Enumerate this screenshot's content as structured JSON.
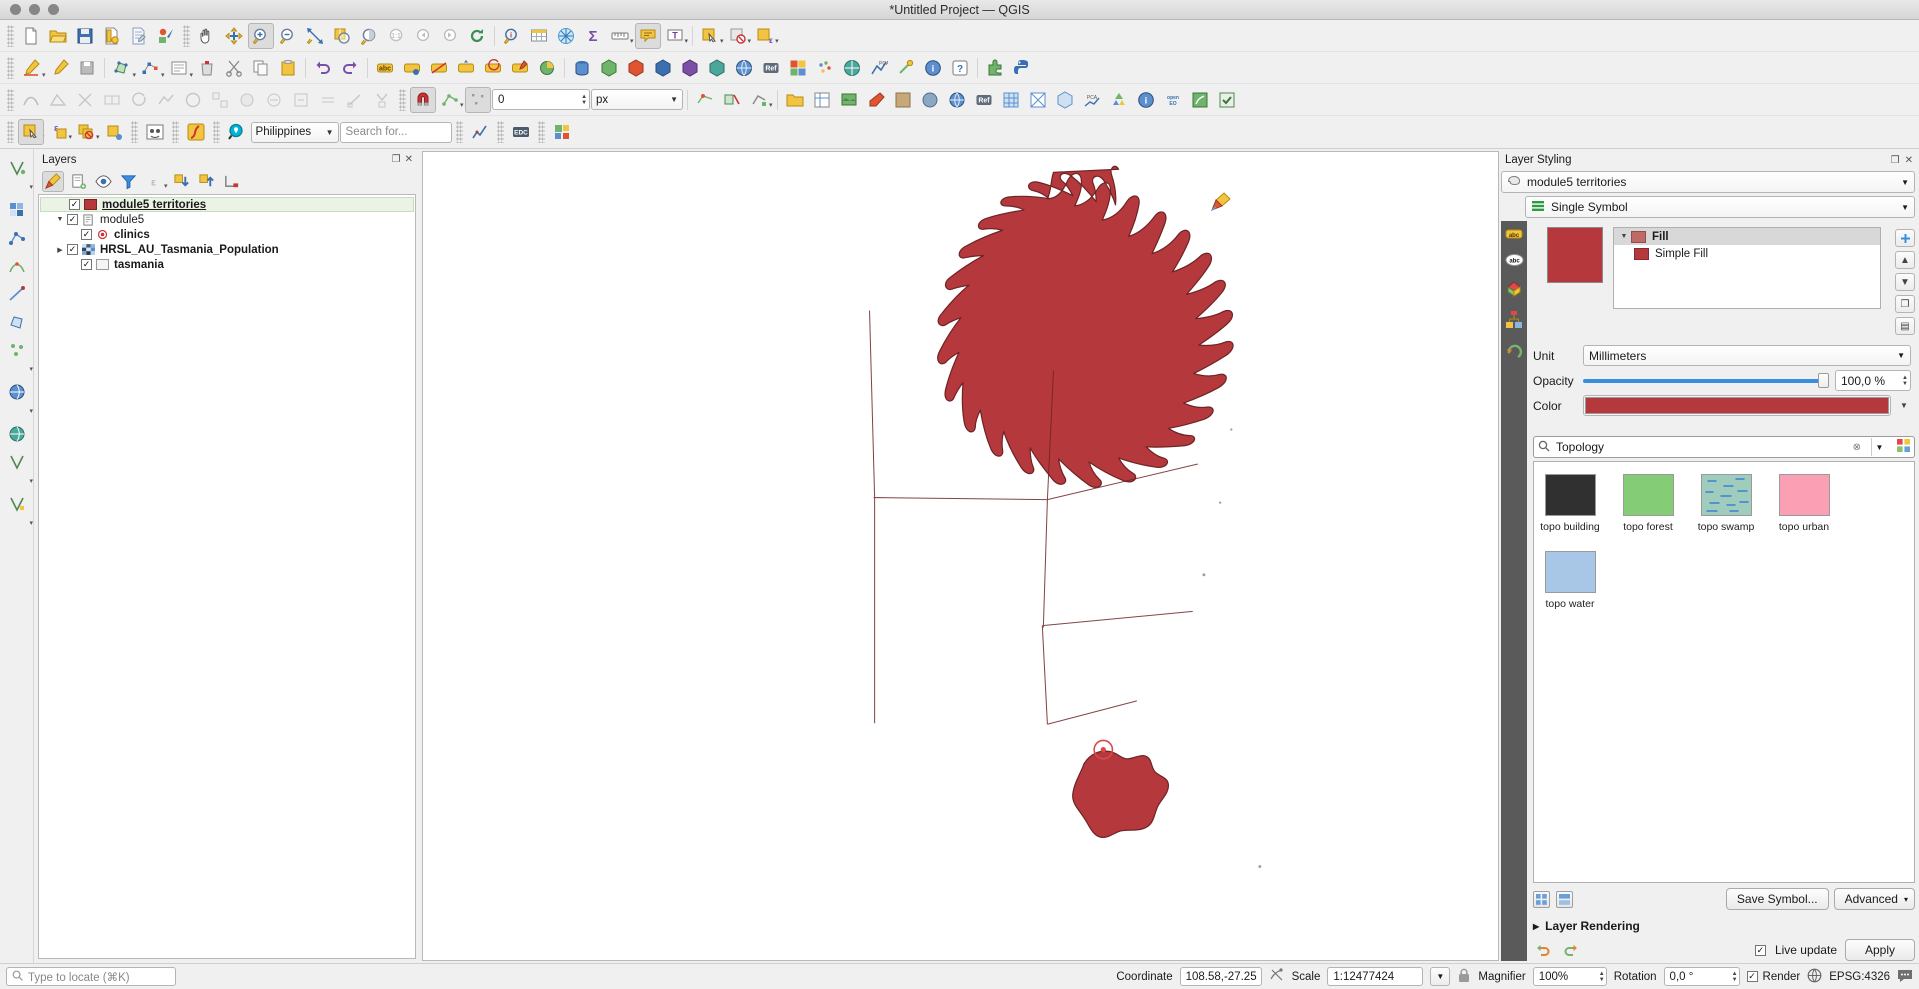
{
  "window": {
    "title": "*Untitled Project — QGIS"
  },
  "toolbars": {
    "row1": [
      {
        "name": "new-project-icon",
        "glyph": "page"
      },
      {
        "name": "open-project-icon",
        "glyph": "folder"
      },
      {
        "name": "save-project-icon",
        "glyph": "save"
      },
      {
        "name": "save-project-as-icon",
        "glyph": "saveas"
      },
      {
        "name": "new-print-layout-icon",
        "glyph": "layout"
      },
      {
        "name": "style-manager-icon",
        "glyph": "style"
      },
      {
        "name": "pan-map-icon",
        "glyph": "hand"
      },
      {
        "name": "pan-to-selection-icon",
        "glyph": "panselect"
      },
      {
        "name": "zoom-in-icon",
        "glyph": "zoomin"
      },
      {
        "name": "zoom-out-icon",
        "glyph": "zoomout"
      },
      {
        "name": "zoom-full-icon",
        "glyph": "zoomfull"
      },
      {
        "name": "zoom-to-selection-icon",
        "glyph": "zoomsel"
      },
      {
        "name": "zoom-to-layer-icon",
        "glyph": "zoomlayer"
      },
      {
        "name": "zoom-native-icon",
        "glyph": "zoomnative"
      },
      {
        "name": "zoom-last-icon",
        "glyph": "zoomlast"
      },
      {
        "name": "zoom-next-icon",
        "glyph": "zoomnext"
      },
      {
        "name": "refresh-icon",
        "glyph": "refresh"
      },
      {
        "name": "identify-features-icon",
        "glyph": "identify"
      },
      {
        "name": "open-attribute-table-icon",
        "glyph": "table"
      },
      {
        "name": "statistical-summary-icon",
        "glyph": "stats"
      },
      {
        "name": "sum-icon",
        "glyph": "sigma"
      },
      {
        "name": "measure-line-icon",
        "glyph": "ruler"
      },
      {
        "name": "map-tips-icon",
        "glyph": "maptip"
      },
      {
        "name": "new-text-annotation-icon",
        "glyph": "textann"
      },
      {
        "name": "deselect-features-icon",
        "glyph": "deselect"
      },
      {
        "name": "select-features-icon",
        "glyph": "select"
      }
    ],
    "row2": [
      {
        "name": "current-edits-icon",
        "glyph": "pencil"
      },
      {
        "name": "toggle-editing-icon",
        "glyph": "editpen"
      },
      {
        "name": "save-layer-edits-icon",
        "glyph": "savelayer"
      },
      {
        "name": "add-feature-icon",
        "glyph": "addfeature"
      },
      {
        "name": "vertex-tool-icon",
        "glyph": "vertex"
      },
      {
        "name": "modify-attributes-icon",
        "glyph": "modifyattr"
      },
      {
        "name": "delete-selected-icon",
        "glyph": "delete"
      },
      {
        "name": "cut-features-icon",
        "glyph": "cut"
      },
      {
        "name": "copy-features-icon",
        "glyph": "copy"
      },
      {
        "name": "paste-features-icon",
        "glyph": "paste"
      },
      {
        "name": "undo-icon",
        "glyph": "undo"
      },
      {
        "name": "redo-icon",
        "glyph": "redo"
      },
      {
        "name": "label-icon",
        "glyph": "abclabel"
      },
      {
        "name": "pin-labels-icon",
        "glyph": "pinlabel"
      },
      {
        "name": "show-hide-labels-icon",
        "glyph": "showlabel"
      },
      {
        "name": "move-label-icon",
        "glyph": "movelabel"
      },
      {
        "name": "rotate-label-icon",
        "glyph": "rotatelabel"
      },
      {
        "name": "change-label-icon",
        "glyph": "changelabel"
      },
      {
        "name": "open-data-source-manager-icon",
        "glyph": "datasource"
      },
      {
        "name": "new-shapefile-layer-icon",
        "glyph": "newshape"
      },
      {
        "name": "new-geopackage-icon",
        "glyph": "geopackage"
      },
      {
        "name": "new-spatialite-icon",
        "glyph": "spatialite"
      },
      {
        "name": "add-wms-layer-icon",
        "glyph": "wms"
      },
      {
        "name": "add-vector-tile-icon",
        "glyph": "vectortile"
      },
      {
        "name": "georeferencer-icon",
        "glyph": "georef"
      },
      {
        "name": "processing-toolbox-icon",
        "glyph": "toolbox"
      },
      {
        "name": "help-icon",
        "glyph": "help"
      },
      {
        "name": "plugin-icon",
        "glyph": "plugin"
      },
      {
        "name": "python-console-icon",
        "glyph": "python"
      }
    ],
    "snapping": {
      "tolerance_value": "0",
      "unit_value": "px"
    },
    "locator": {
      "scope_label": "Philippines",
      "search_placeholder": "Search for..."
    }
  },
  "layers_panel": {
    "title": "Layers",
    "toolbar_buttons": [
      {
        "name": "open-layer-styling-panel-icon"
      },
      {
        "name": "add-group-icon"
      },
      {
        "name": "manage-map-themes-icon"
      },
      {
        "name": "filter-legend-icon"
      },
      {
        "name": "filter-legend-expression-icon"
      },
      {
        "name": "expand-all-icon"
      },
      {
        "name": "collapse-all-icon"
      },
      {
        "name": "remove-layer-icon"
      }
    ],
    "tree": [
      {
        "name": "module5 territories",
        "checked": true,
        "selected": true,
        "bold": true,
        "underline": true,
        "symbol": "fill-red",
        "indent": 1,
        "twisty": ""
      },
      {
        "name": "module5",
        "checked": true,
        "selected": false,
        "bold": false,
        "underline": false,
        "symbol": "geopackage",
        "indent": 0,
        "twisty": "▾"
      },
      {
        "name": "clinics",
        "checked": true,
        "selected": false,
        "bold": true,
        "underline": false,
        "symbol": "point-red",
        "indent": 2,
        "twisty": ""
      },
      {
        "name": "HRSL_AU_Tasmania_Population",
        "checked": true,
        "selected": false,
        "bold": true,
        "underline": false,
        "symbol": "raster",
        "indent": 2,
        "twisty": "▸"
      },
      {
        "name": "tasmania",
        "checked": true,
        "selected": false,
        "bold": true,
        "underline": false,
        "symbol": "fill-white",
        "indent": 2,
        "twisty": ""
      }
    ]
  },
  "styling_panel": {
    "title": "Layer Styling",
    "layer_name": "module5 territories",
    "renderer": "Single Symbol",
    "vtabs": [
      {
        "name": "labels-tab",
        "glyph": "abc-tag"
      },
      {
        "name": "masks-tab",
        "glyph": "abc-mask"
      },
      {
        "name": "3d-view-tab",
        "glyph": "cube"
      },
      {
        "name": "diagrams-tab",
        "glyph": "diagram"
      },
      {
        "name": "history-tab",
        "glyph": "history"
      }
    ],
    "symbol_tree": [
      {
        "label": "Fill",
        "color": "#c06a66",
        "header": true
      },
      {
        "label": "Simple Fill",
        "color": "#b5393c",
        "header": false
      }
    ],
    "side_buttons": [
      "add",
      "up",
      "down",
      "duplicate",
      "remove"
    ],
    "properties": {
      "unit_label": "Unit",
      "unit_value": "Millimeters",
      "opacity_label": "Opacity",
      "opacity_value": "100,0 %",
      "color_label": "Color",
      "color_value": "#b5393c"
    },
    "library": {
      "search_value": "Topology",
      "items": [
        {
          "label": "topo building",
          "color": "#303030",
          "pattern": "solid"
        },
        {
          "label": "topo forest",
          "color": "#85cc77",
          "pattern": "solid"
        },
        {
          "label": "topo swamp",
          "color": "#9fccbd",
          "pattern": "swamp"
        },
        {
          "label": "topo urban",
          "color": "#fba0b4",
          "pattern": "solid"
        },
        {
          "label": "topo water",
          "color": "#a8c6e5",
          "pattern": "solid"
        }
      ]
    },
    "save_symbol_label": "Save Symbol...",
    "advanced_label": "Advanced",
    "layer_rendering_label": "Layer Rendering",
    "live_update_label": "Live update",
    "live_update_checked": true,
    "apply_label": "Apply"
  },
  "statusbar": {
    "locator_placeholder": "Type to locate (⌘K)",
    "coordinate_label": "Coordinate",
    "coordinate_value": "108.58,-27.25",
    "scale_label": "Scale",
    "scale_value": "1:12477424",
    "magnifier_label": "Magnifier",
    "magnifier_value": "100%",
    "rotation_label": "Rotation",
    "rotation_value": "0,0 °",
    "render_label": "Render",
    "render_checked": true,
    "crs_label": "EPSG:4326",
    "messages_icon": "message-log-icon"
  },
  "map": {
    "fill_color": "#b5393c",
    "stroke_color": "#6d2426",
    "background": "#ffffff"
  },
  "colors": {
    "accent": "#b5393c",
    "selection": "#eaf3e6",
    "panel_bg": "#f0f0f0",
    "vtab_bg": "#5a5a5a",
    "slider": "#3b8ede"
  }
}
